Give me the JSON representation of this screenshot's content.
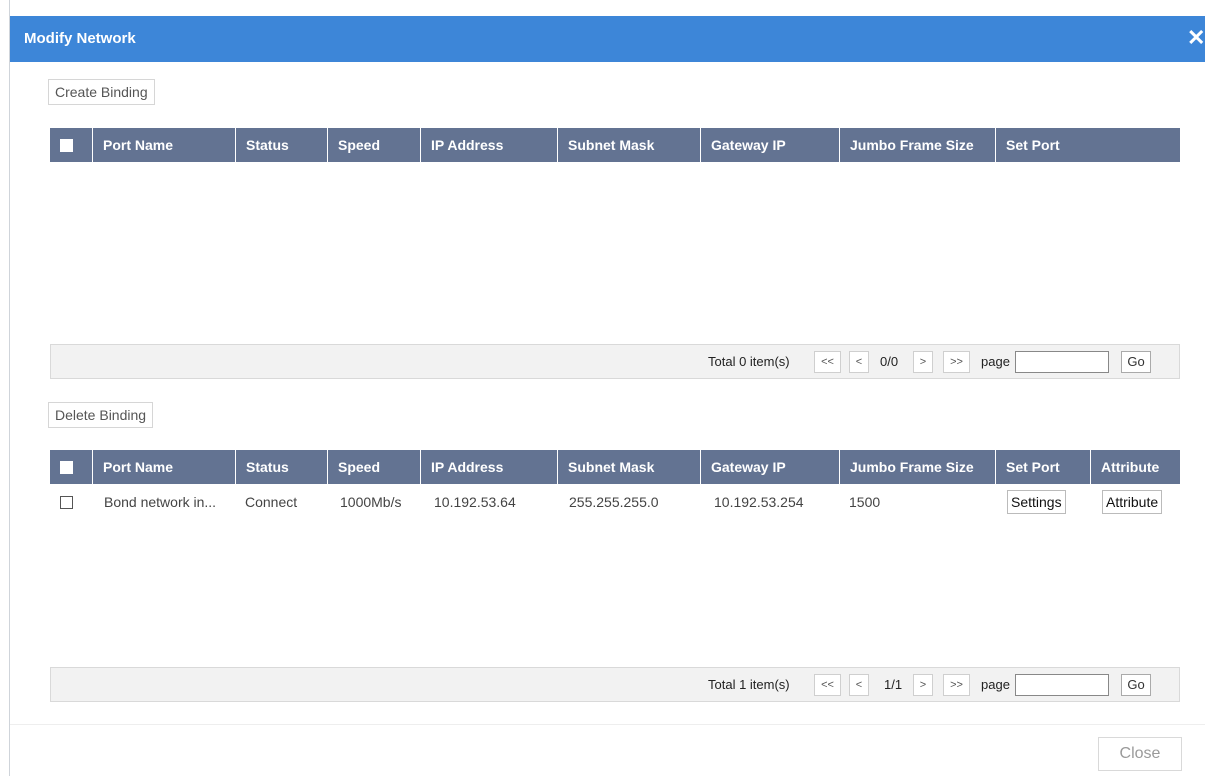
{
  "dialog": {
    "title": "Modify Network",
    "close_symbol": "✕"
  },
  "top_section": {
    "action_label": "Create Binding",
    "columns": [
      "Port Name",
      "Status",
      "Speed",
      "IP Address",
      "Subnet Mask",
      "Gateway IP",
      "Jumbo Frame Size",
      "Set Port"
    ],
    "rows": [],
    "pager": {
      "total": "Total 0 item(s)",
      "first": "<<",
      "prev": "<",
      "page_info": "0/0",
      "next": ">",
      "last": ">>",
      "page_label": "page",
      "page_input_value": "",
      "go_label": "Go"
    }
  },
  "bottom_section": {
    "action_label": "Delete Binding",
    "columns": [
      "Port Name",
      "Status",
      "Speed",
      "IP Address",
      "Subnet Mask",
      "Gateway IP",
      "Jumbo Frame Size",
      "Set Port",
      "Attribute"
    ],
    "rows": [
      {
        "port_name": "Bond network in...",
        "status": "Connect",
        "speed": "1000Mb/s",
        "ip": "10.192.53.64",
        "subnet": "255.255.255.0",
        "gateway": "10.192.53.254",
        "jumbo": "1500",
        "set_port_label": "Settings",
        "attribute_label": "Attribute"
      }
    ],
    "pager": {
      "total": "Total 1 item(s)",
      "first": "<<",
      "prev": "<",
      "page_info": "1/1",
      "next": ">",
      "last": ">>",
      "page_label": "page",
      "page_input_value": "",
      "go_label": "Go"
    }
  },
  "footer": {
    "close_label": "Close"
  },
  "colors": {
    "titlebar": "#3d86d8",
    "table_header": "#637392"
  }
}
